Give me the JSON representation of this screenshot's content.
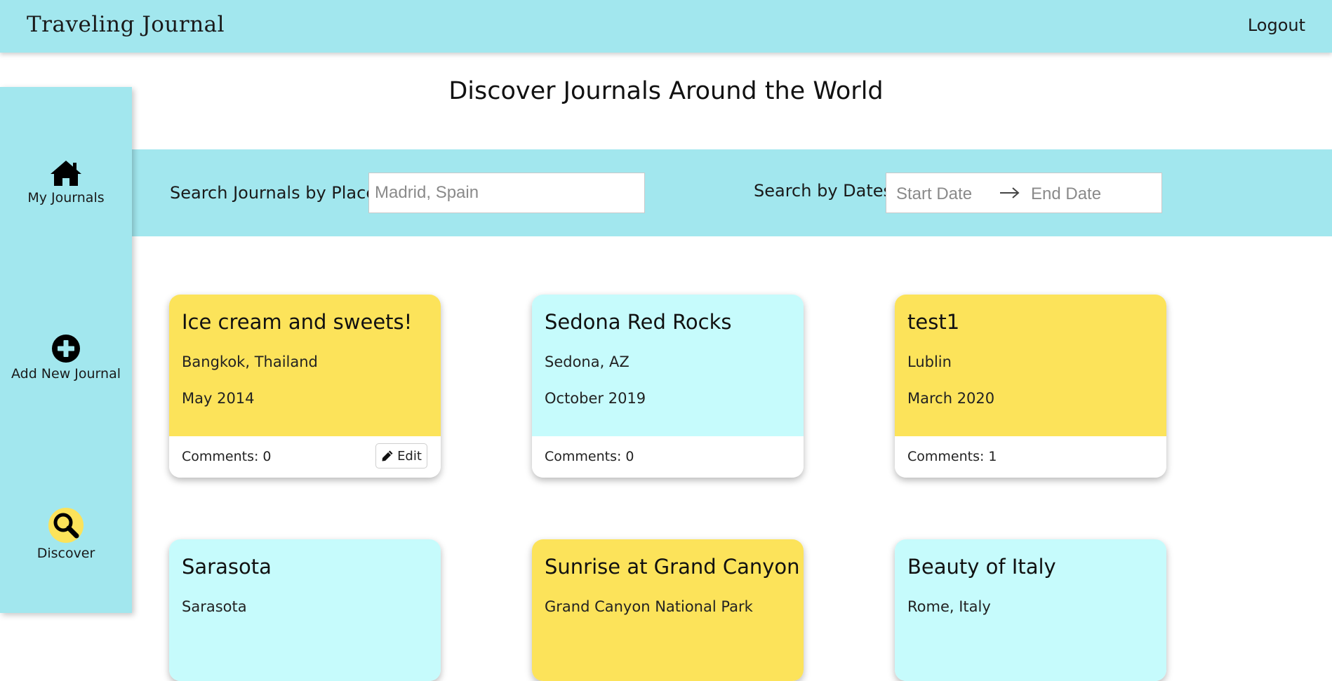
{
  "header": {
    "brand": "Traveling Journal",
    "logout_label": "Logout"
  },
  "sidebar": {
    "items": [
      {
        "label": "My Journals",
        "icon": "home-icon"
      },
      {
        "label": "Add New Journal",
        "icon": "plus-circle-icon"
      },
      {
        "label": "Discover",
        "icon": "search-icon",
        "active": true
      }
    ]
  },
  "main": {
    "title": "Discover Journals Around the World",
    "search": {
      "place_label": "Search Journals by Place",
      "place_placeholder": "Madrid, Spain",
      "dates_label": "Search by Dates",
      "start_placeholder": "Start Date",
      "end_placeholder": "End Date"
    },
    "journals": [
      {
        "title": "Ice cream and sweets!",
        "place": "Bangkok, Thailand",
        "date": "May 2014",
        "comments": "Comments: 0",
        "edit_label": "Edit",
        "color": "#fce35a"
      },
      {
        "title": "Sedona Red Rocks",
        "place": "Sedona, AZ",
        "date": "October 2019",
        "comments": "Comments: 0",
        "color": "#c6fbfc"
      },
      {
        "title": "test1",
        "place": "Lublin",
        "date": "March 2020",
        "comments": "Comments: 1",
        "color": "#fce35a"
      },
      {
        "title": "Sarasota",
        "place": "Sarasota",
        "color": "#c6fbfc"
      },
      {
        "title": "Sunrise at Grand Canyon",
        "place": "Grand Canyon National Park",
        "color": "#fce35a"
      },
      {
        "title": "Beauty of Italy",
        "place": "Rome, Italy",
        "color": "#c6fbfc"
      }
    ]
  },
  "colors": {
    "header_bg": "#a2e7ee",
    "card_yellow": "#fce35a",
    "card_cyan": "#c6fbfc",
    "active_icon_bg": "#fce35a"
  }
}
